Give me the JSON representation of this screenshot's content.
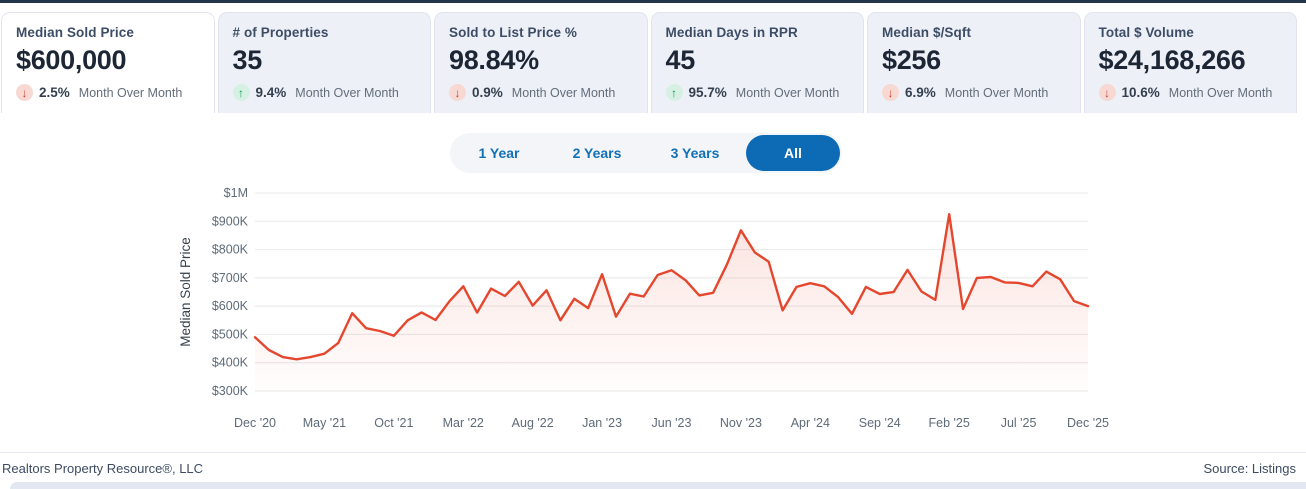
{
  "kpi_cards": [
    {
      "title": "Median Sold Price",
      "value": "$600,000",
      "delta": "2.5%",
      "direction": "down",
      "period": "Month Over Month",
      "active": true
    },
    {
      "title": "# of Properties",
      "value": "35",
      "delta": "9.4%",
      "direction": "up",
      "period": "Month Over Month",
      "active": false
    },
    {
      "title": "Sold to List Price %",
      "value": "98.84%",
      "delta": "0.9%",
      "direction": "down",
      "period": "Month Over Month",
      "active": false
    },
    {
      "title": "Median Days in RPR",
      "value": "45",
      "delta": "95.7%",
      "direction": "up",
      "period": "Month Over Month",
      "active": false
    },
    {
      "title": "Median $/Sqft",
      "value": "$256",
      "delta": "6.9%",
      "direction": "down",
      "period": "Month Over Month",
      "active": false
    },
    {
      "title": "Total $ Volume",
      "value": "$24,168,266",
      "delta": "10.6%",
      "direction": "down",
      "period": "Month Over Month",
      "active": false
    }
  ],
  "icons": {
    "down": "↓",
    "up": "↑"
  },
  "time_tabs": {
    "options": [
      "1 Year",
      "2 Years",
      "3 Years",
      "All"
    ],
    "selected": "All"
  },
  "chart_data": {
    "type": "area",
    "ylabel": "Median Sold Price",
    "y_tick_labels": [
      "$1M",
      "$900K",
      "$800K",
      "$700K",
      "$600K",
      "$500K",
      "$400K",
      "$300K"
    ],
    "ylim_k": [
      300,
      1000
    ],
    "x_tick_labels": [
      "Dec '20",
      "May '21",
      "Oct '21",
      "Mar '22",
      "Aug '22",
      "Jan '23",
      "Jun '23",
      "Nov '23",
      "Apr '24",
      "Sep '24",
      "Feb '25",
      "Jul '25",
      "Dec '25"
    ],
    "x_tick_every": 5,
    "grid": true,
    "legend": "none",
    "series": [
      {
        "name": "Median Sold Price",
        "color": "#e5472e",
        "values_k": [
          490,
          445,
          420,
          412,
          420,
          432,
          470,
          575,
          522,
          512,
          495,
          550,
          578,
          551,
          617,
          670,
          577,
          662,
          636,
          686,
          602,
          656,
          550,
          626,
          593,
          713,
          563,
          644,
          634,
          710,
          727,
          692,
          638,
          647,
          748,
          868,
          790,
          757,
          585,
          668,
          681,
          670,
          632,
          573,
          668,
          643,
          650,
          728,
          652,
          622,
          925,
          590,
          700,
          703,
          684,
          682,
          670,
          722,
          695,
          618,
          600
        ]
      }
    ]
  },
  "footer": {
    "left": "Realtors Property Resource®, LLC",
    "right": "Source: Listings"
  },
  "colors": {
    "top_strip": "#22334a",
    "card_bg": "#eef0f7",
    "card_active_bg": "#ffffff",
    "card_border": "#e1e4f0",
    "tab_blue": "#1270b6",
    "tab_active_bg": "#0d6bb5",
    "line_red": "#e5472e",
    "grid": "#e8e8e8",
    "axis_text": "#5f6b78",
    "down_red": "#cf4130",
    "up_green": "#119c62"
  }
}
